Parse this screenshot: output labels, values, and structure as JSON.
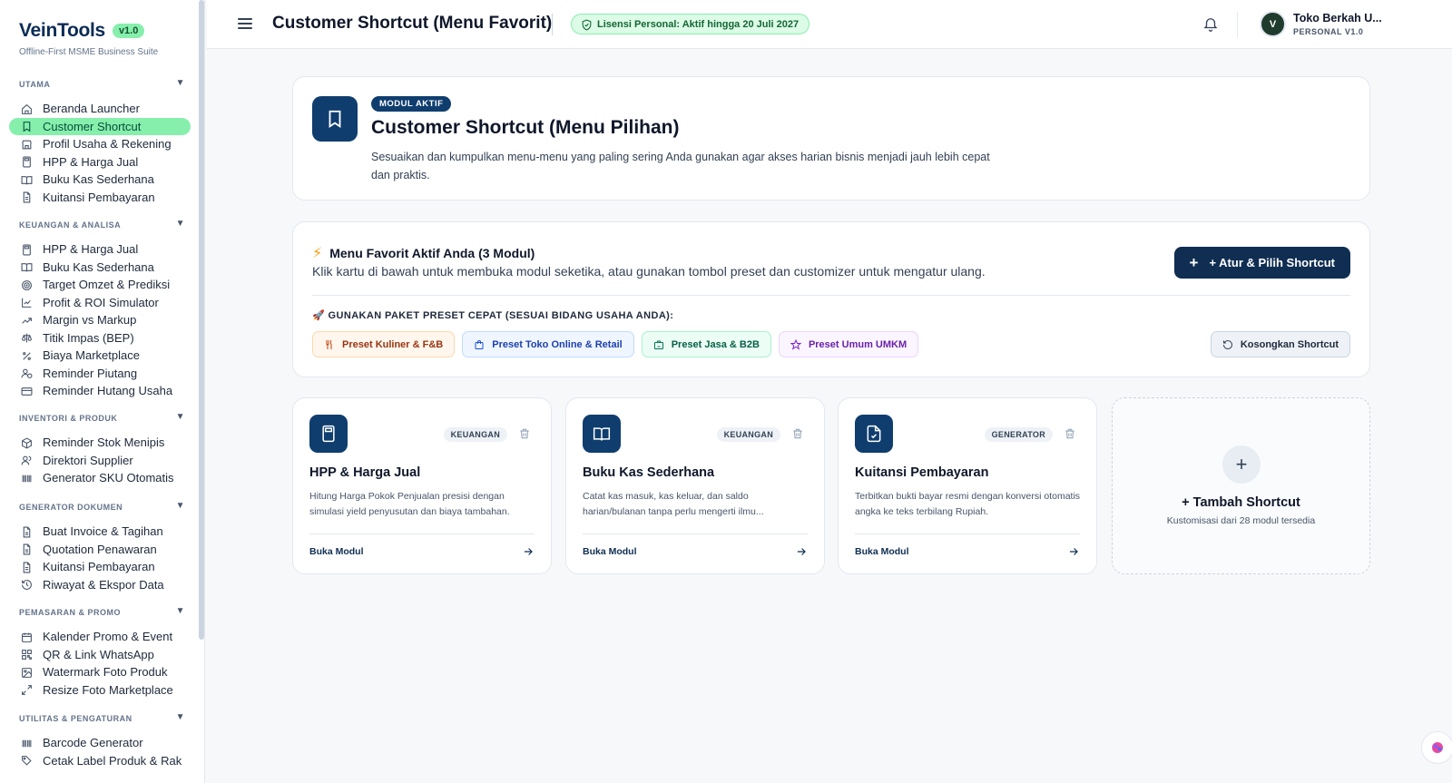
{
  "brand": {
    "name": "VeinTools",
    "version": "v1.0",
    "tagline": "Offline-First MSME Business Suite"
  },
  "sidebar": {
    "sections": [
      {
        "title": "UTAMA",
        "items": [
          {
            "label": "Beranda Launcher",
            "icon": "home-icon"
          },
          {
            "label": "Customer Shortcut",
            "icon": "bookmark-icon",
            "active": true
          },
          {
            "label": "Profil Usaha & Rekening",
            "icon": "store-icon"
          },
          {
            "label": "HPP & Harga Jual",
            "icon": "calculator-icon"
          },
          {
            "label": "Buku Kas Sederhana",
            "icon": "book-icon"
          },
          {
            "label": "Kuitansi Pembayaran",
            "icon": "receipt-icon"
          }
        ]
      },
      {
        "title": "KEUANGAN & ANALISA",
        "items": [
          {
            "label": "HPP & Harga Jual",
            "icon": "calculator-icon"
          },
          {
            "label": "Buku Kas Sederhana",
            "icon": "book-icon"
          },
          {
            "label": "Target Omzet & Prediksi",
            "icon": "target-icon"
          },
          {
            "label": "Profit & ROI Simulator",
            "icon": "chart-icon"
          },
          {
            "label": "Margin vs Markup",
            "icon": "trend-icon"
          },
          {
            "label": "Titik Impas (BEP)",
            "icon": "scale-icon"
          },
          {
            "label": "Biaya Marketplace",
            "icon": "percent-icon"
          },
          {
            "label": "Reminder Piutang",
            "icon": "user-clock-icon"
          },
          {
            "label": "Reminder Hutang Usaha",
            "icon": "card-icon"
          }
        ]
      },
      {
        "title": "INVENTORI & PRODUK",
        "items": [
          {
            "label": "Reminder Stok Menipis",
            "icon": "box-icon"
          },
          {
            "label": "Direktori Supplier",
            "icon": "users-icon"
          },
          {
            "label": "Generator SKU Otomatis",
            "icon": "barcode-icon"
          }
        ]
      },
      {
        "title": "GENERATOR DOKUMEN",
        "items": [
          {
            "label": "Buat Invoice & Tagihan",
            "icon": "file-icon"
          },
          {
            "label": "Quotation Penawaran",
            "icon": "file-icon"
          },
          {
            "label": "Kuitansi Pembayaran",
            "icon": "receipt-icon"
          },
          {
            "label": "Riwayat & Ekspor Data",
            "icon": "history-icon"
          }
        ]
      },
      {
        "title": "PEMASARAN & PROMO",
        "items": [
          {
            "label": "Kalender Promo & Event",
            "icon": "calendar-icon"
          },
          {
            "label": "QR & Link WhatsApp",
            "icon": "qr-icon"
          },
          {
            "label": "Watermark Foto Produk",
            "icon": "image-icon"
          },
          {
            "label": "Resize Foto Marketplace",
            "icon": "resize-icon"
          }
        ]
      },
      {
        "title": "UTILITAS & PENGATURAN",
        "items": [
          {
            "label": "Barcode Generator",
            "icon": "barcode-icon"
          },
          {
            "label": "Cetak Label Produk & Rak",
            "icon": "tag-icon"
          }
        ]
      }
    ]
  },
  "header": {
    "title": "Customer Shortcut (Menu Favorit)",
    "license": "Lisensi Personal: Aktif hingga 20 Juli 2027",
    "user_name": "Toko Berkah U...",
    "user_role": "PERSONAL V1.0"
  },
  "hero": {
    "badge": "MODUL AKTIF",
    "title": "Customer Shortcut (Menu Pilihan)",
    "desc": "Sesuaikan dan kumpulkan menu-menu yang paling sering Anda gunakan agar akses harian bisnis menjadi jauh lebih cepat dan praktis."
  },
  "favorites": {
    "title": "Menu Favorit Aktif Anda (3 Modul)",
    "desc": "Klik kartu di bawah untuk membuka modul seketika, atau gunakan tombol preset dan customizer untuk mengatur ulang.",
    "button": "+ Atur & Pilih Shortcut",
    "preset_heading": "🚀 GUNAKAN PAKET PRESET CEPAT (SESUAI BIDANG USAHA ANDA):",
    "presets": [
      {
        "label": "Preset Kuliner & F&B"
      },
      {
        "label": "Preset Toko Online & Retail"
      },
      {
        "label": "Preset Jasa & B2B"
      },
      {
        "label": "Preset Umum UMKM"
      }
    ],
    "clear_button": "Kosongkan Shortcut"
  },
  "modules": [
    {
      "title": "HPP & Harga Jual",
      "tag": "KEUANGAN",
      "desc": "Hitung Harga Pokok Penjualan presisi dengan simulasi yield penyusutan dan biaya tambahan.",
      "link": "Buka Modul"
    },
    {
      "title": "Buku Kas Sederhana",
      "tag": "KEUANGAN",
      "desc": "Catat kas masuk, kas keluar, dan saldo harian/bulanan tanpa perlu mengerti ilmu...",
      "link": "Buka Modul"
    },
    {
      "title": "Kuitansi Pembayaran",
      "tag": "GENERATOR",
      "desc": "Terbitkan bukti bayar resmi dengan konversi otomatis angka ke teks terbilang Rupiah.",
      "link": "Buka Modul"
    }
  ],
  "add_card": {
    "title": "+ Tambah Shortcut",
    "sub": "Kustomisasi dari 28 modul tersedia"
  }
}
